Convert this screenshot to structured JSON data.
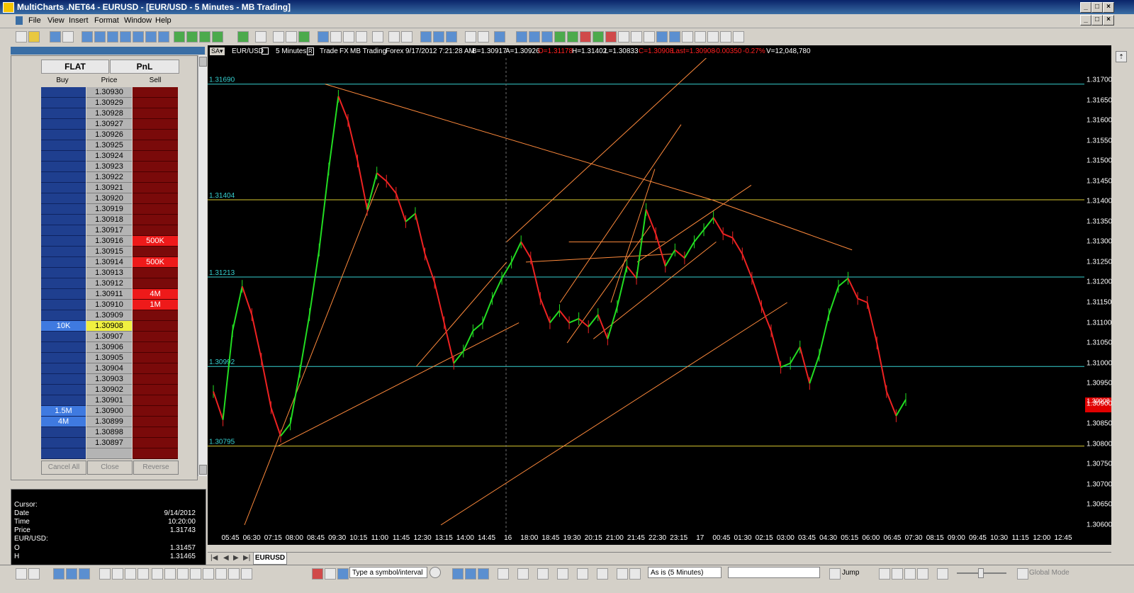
{
  "window": {
    "title": "MultiCharts .NET64 - EURUSD - [EUR/USD - 5 Minutes - MB Trading]"
  },
  "menu": [
    "File",
    "View",
    "Insert",
    "Format",
    "Window",
    "Help"
  ],
  "dom": {
    "tab_flat": "FLAT",
    "tab_pnl": "PnL",
    "col_buy": "Buy",
    "col_price": "Price",
    "col_sell": "Sell",
    "rows": [
      {
        "buy": "",
        "price": "1.30930",
        "sell": ""
      },
      {
        "buy": "",
        "price": "1.30929",
        "sell": ""
      },
      {
        "buy": "",
        "price": "1.30928",
        "sell": ""
      },
      {
        "buy": "",
        "price": "1.30927",
        "sell": ""
      },
      {
        "buy": "",
        "price": "1.30926",
        "sell": ""
      },
      {
        "buy": "",
        "price": "1.30925",
        "sell": ""
      },
      {
        "buy": "",
        "price": "1.30924",
        "sell": ""
      },
      {
        "buy": "",
        "price": "1.30923",
        "sell": ""
      },
      {
        "buy": "",
        "price": "1.30922",
        "sell": ""
      },
      {
        "buy": "",
        "price": "1.30921",
        "sell": ""
      },
      {
        "buy": "",
        "price": "1.30920",
        "sell": ""
      },
      {
        "buy": "",
        "price": "1.30919",
        "sell": ""
      },
      {
        "buy": "",
        "price": "1.30918",
        "sell": ""
      },
      {
        "buy": "",
        "price": "1.30917",
        "sell": ""
      },
      {
        "buy": "",
        "price": "1.30916",
        "sell": "500K"
      },
      {
        "buy": "",
        "price": "1.30915",
        "sell": ""
      },
      {
        "buy": "",
        "price": "1.30914",
        "sell": "500K"
      },
      {
        "buy": "",
        "price": "1.30913",
        "sell": ""
      },
      {
        "buy": "",
        "price": "1.30912",
        "sell": ""
      },
      {
        "buy": "",
        "price": "1.30911",
        "sell": "4M"
      },
      {
        "buy": "",
        "price": "1.30910",
        "sell": "1M"
      },
      {
        "buy": "",
        "price": "1.30909",
        "sell": ""
      },
      {
        "buy": "10K",
        "price": "1.30908",
        "sell": ""
      },
      {
        "buy": "",
        "price": "1.30907",
        "sell": ""
      },
      {
        "buy": "",
        "price": "1.30906",
        "sell": ""
      },
      {
        "buy": "",
        "price": "1.30905",
        "sell": ""
      },
      {
        "buy": "",
        "price": "1.30904",
        "sell": ""
      },
      {
        "buy": "",
        "price": "1.30903",
        "sell": ""
      },
      {
        "buy": "",
        "price": "1.30902",
        "sell": ""
      },
      {
        "buy": "",
        "price": "1.30901",
        "sell": ""
      },
      {
        "buy": "1.5M",
        "price": "1.30900",
        "sell": ""
      },
      {
        "buy": "4M",
        "price": "1.30899",
        "sell": ""
      },
      {
        "buy": "",
        "price": "1.30898",
        "sell": ""
      },
      {
        "buy": "",
        "price": "1.30897",
        "sell": ""
      },
      {
        "buy": "",
        "price": "",
        "sell": ""
      }
    ],
    "btn_cancel_all": "Cancel All",
    "btn_close": "Close",
    "btn_reverse": "Reverse"
  },
  "data_window": {
    "cursor_label": "Cursor:",
    "date_label": "Date",
    "date": "9/14/2012",
    "time_label": "Time",
    "time": "10:20:00",
    "price_label": "Price",
    "price": "1.31743",
    "symbol_label": "EUR/USD:",
    "o_label": "O",
    "o": "1.31457",
    "h_label": "H",
    "h": "1.31465"
  },
  "status_bar": {
    "symbol": "EUR/USD",
    "interval": "5 Minutes",
    "trade": "Trade",
    "fx": "FX",
    "broker": "MB Trading",
    "market": "Forex",
    "datetime": "9/17/2012  7:21:28 AM",
    "bid": "B=1.30917",
    "ask": "A=1.30926",
    "open": "O=1.31178",
    "high": "H=1.31402",
    "low": "L=1.30833",
    "close": "C=1.30908",
    "last": "Last=1.30908",
    "change": "-0.00350",
    "change_pct": "-0.27%",
    "volume": "V=12,048,780"
  },
  "chart_data": {
    "type": "line",
    "title": "EUR/USD - 5 Minutes",
    "xlabel": "",
    "ylabel": "",
    "ylim": [
      1.30575,
      1.3175
    ],
    "x_ticks": [
      "05:45",
      "06:30",
      "07:15",
      "08:00",
      "08:45",
      "09:30",
      "10:15",
      "11:00",
      "11:45",
      "12:30",
      "13:15",
      "14:00",
      "14:45",
      "16",
      "18:00",
      "18:45",
      "19:30",
      "20:15",
      "21:00",
      "21:45",
      "22:30",
      "23:15",
      "17",
      "00:45",
      "01:30",
      "02:15",
      "03:00",
      "03:45",
      "04:30",
      "05:15",
      "06:00",
      "06:45",
      "07:30",
      "08:15",
      "09:00",
      "09:45",
      "10:30",
      "11:15",
      "12:00",
      "12:45"
    ],
    "y_ticks": [
      "1.31700",
      "1.31650",
      "1.31600",
      "1.31550",
      "1.31500",
      "1.31450",
      "1.31400",
      "1.31350",
      "1.31300",
      "1.31250",
      "1.31200",
      "1.31150",
      "1.31100",
      "1.31050",
      "1.31000",
      "1.30950",
      "1.30900",
      "1.30850",
      "1.30800",
      "1.30750",
      "1.30700",
      "1.30650",
      "1.30600"
    ],
    "horizontal_lines": [
      {
        "label": "1.31690",
        "value": 1.3169,
        "color": "#36d0d0"
      },
      {
        "label": "1.31404",
        "value": 1.31404,
        "color": "#d8c830"
      },
      {
        "label": "1.31213",
        "value": 1.31213,
        "color": "#36d0d0"
      },
      {
        "label": "1.30992",
        "value": 1.30992,
        "color": "#36d0d0"
      },
      {
        "label": "1.30795",
        "value": 1.30795,
        "color": "#d8c830"
      }
    ],
    "last_price_label": "1.30908",
    "series": [
      {
        "values": [
          1.3093,
          1.3086,
          1.3108,
          1.3119,
          1.3112,
          1.3101,
          1.3089,
          1.3082,
          1.3085,
          1.3098,
          1.3112,
          1.3128,
          1.3148,
          1.3166,
          1.316,
          1.315,
          1.3138,
          1.3147,
          1.3145,
          1.3142,
          1.3135,
          1.3137,
          1.3127,
          1.312,
          1.311,
          1.31,
          1.3103,
          1.3108,
          1.311,
          1.3116,
          1.3121,
          1.3125,
          1.313,
          1.3126,
          1.3116,
          1.311,
          1.3113,
          1.311,
          1.3111,
          1.3109,
          1.3112,
          1.3106,
          1.3114,
          1.3124,
          1.3121,
          1.3138,
          1.3132,
          1.3124,
          1.3128,
          1.3126,
          1.313,
          1.3133,
          1.3136,
          1.3132,
          1.3131,
          1.3127,
          1.3121,
          1.3114,
          1.3108,
          1.3099,
          1.31,
          1.3104,
          1.3095,
          1.3102,
          1.3112,
          1.3119,
          1.3121,
          1.3116,
          1.3115,
          1.3105,
          1.3093,
          1.3087,
          1.3091
        ]
      }
    ]
  },
  "tab": {
    "label": "EURUSD"
  },
  "bottom": {
    "symbol_input": "Type a symbol/interval",
    "resolution_select": "As is (5 Minutes)",
    "jump_label": "Jump",
    "global_mode": "Global Mode"
  }
}
